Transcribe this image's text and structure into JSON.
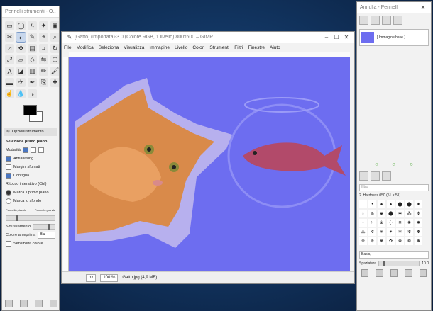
{
  "toolbox": {
    "title": "Pennelli strumenti - O...",
    "tool_options_tab": "Opzioni strumento",
    "tool_name": "Selezione primo piano",
    "mode_label": "Modalità",
    "antialiasing": "Antialiasing",
    "feather": "Margini sfumati",
    "contiguous": "Contigua",
    "interactive_refinement": "Ritocco interattivo (Ctrl)",
    "mark_foreground": "Marca il primo piano",
    "mark_background": "Marca lo sfondo",
    "stroke_small": "Pennello piccolo",
    "stroke_large": "Pennello grande",
    "smoothing": "Smussamento",
    "preview_color_label": "Colore anteprima",
    "preview_color_value": "Blu",
    "color_sensitivity": "Sensibilità colore"
  },
  "main": {
    "title": "[Gatto] (importata)-3.0 (Colore RGB, 1 livello) 800x600 – GIMP",
    "menu": [
      "File",
      "Modifica",
      "Seleziona",
      "Visualizza",
      "Immagine",
      "Livello",
      "Colori",
      "Strumenti",
      "Filtri",
      "Finestre",
      "Aiuto"
    ],
    "status_unit": "px",
    "status_zoom": "100 %",
    "status_file": "Gatto.jpg (4,9 MB)"
  },
  "dock": {
    "title": "Annulla - Pennelli",
    "history_item": "[ Immagine base ]",
    "filter_placeholder": "filtro",
    "brush_name": "2. Hardness 050 (51 × 51)",
    "brush_set": "Basic,",
    "spacing_label": "Spaziatura",
    "spacing_value": "10.0"
  },
  "colors": {
    "canvas_mask": "#6d6df0",
    "foreground": "#000000",
    "background": "#ffffff"
  }
}
